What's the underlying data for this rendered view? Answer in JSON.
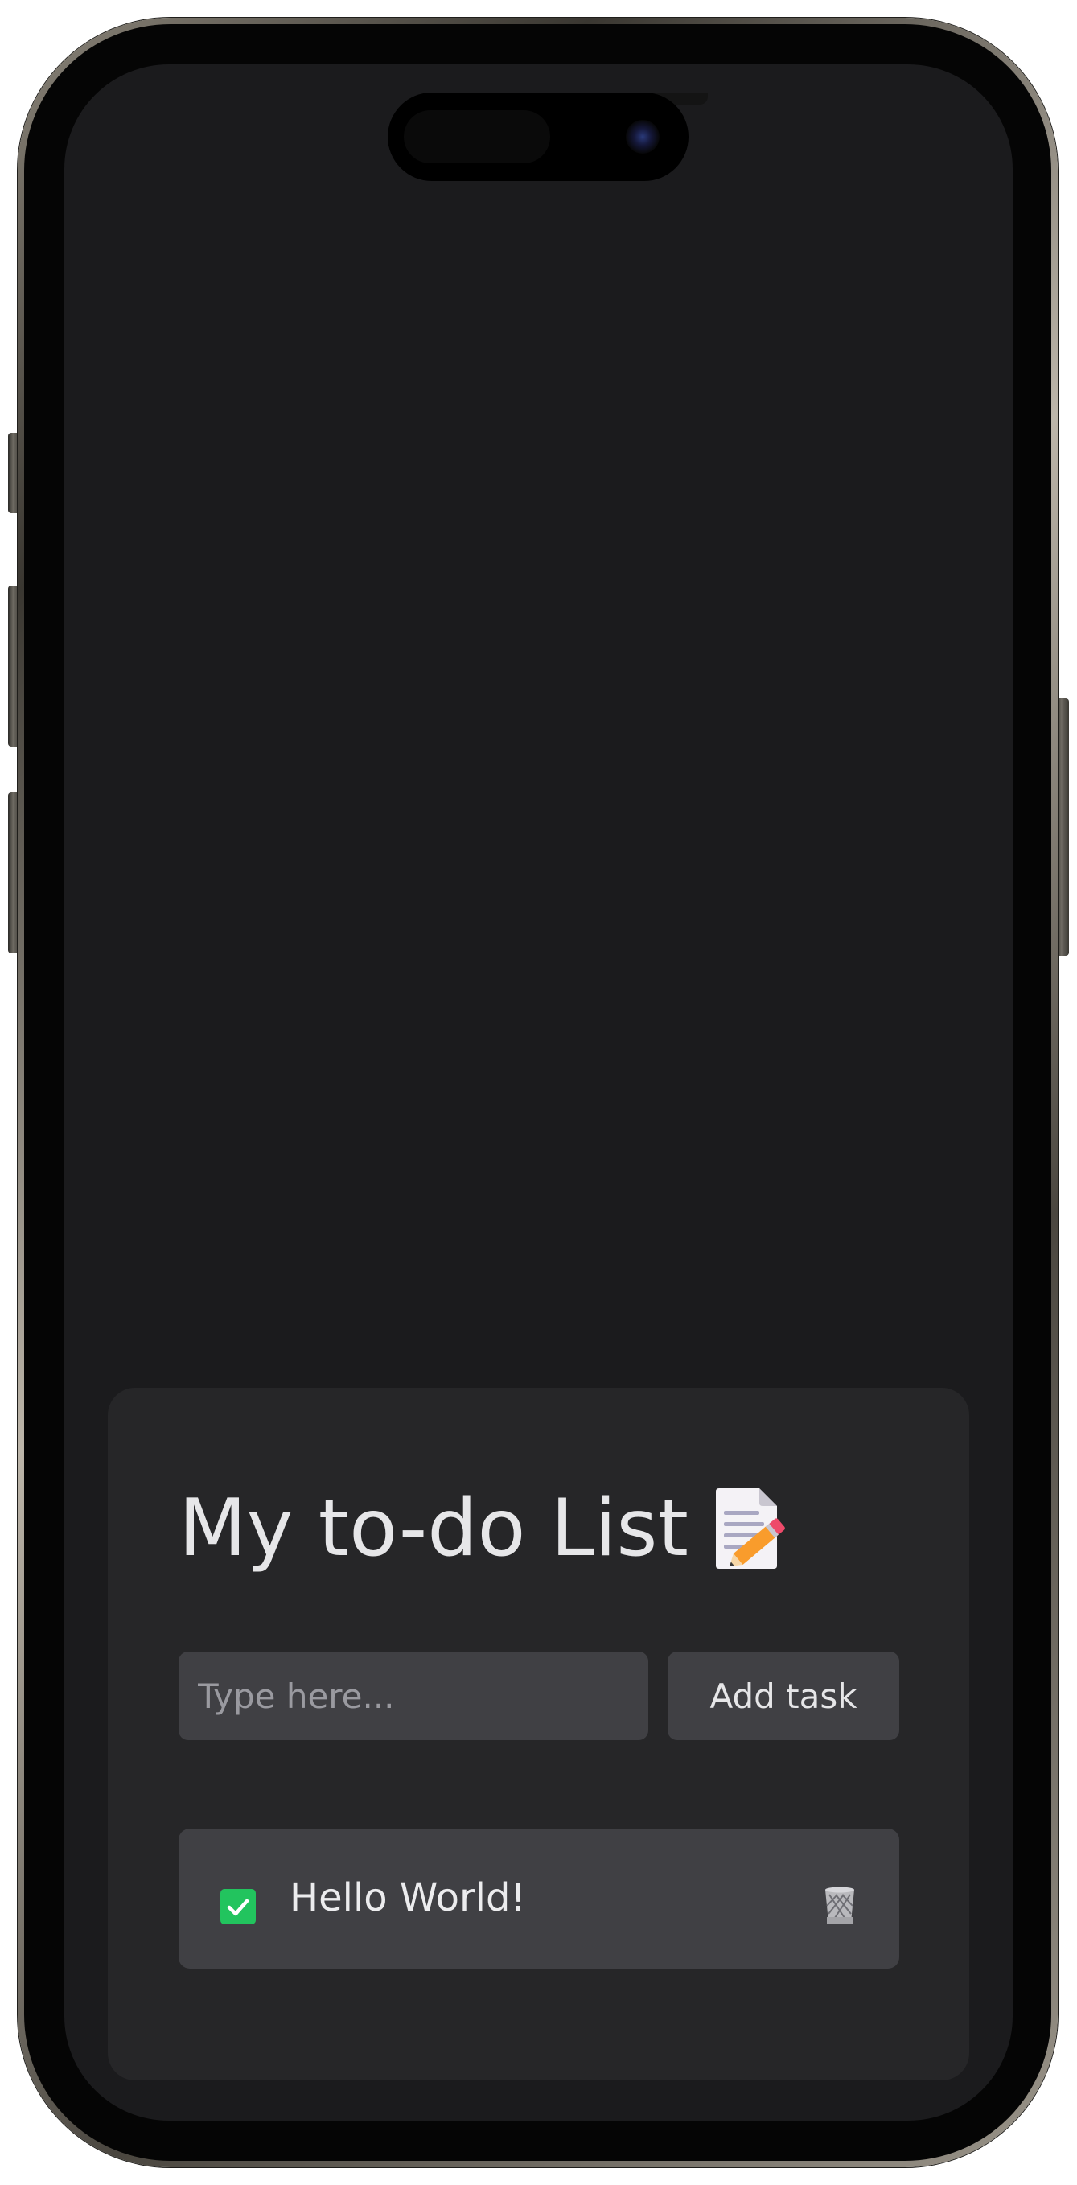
{
  "app": {
    "title": "My to-do List",
    "title_icon": "memo-icon"
  },
  "input": {
    "placeholder": "Type here...",
    "value": ""
  },
  "add_button": {
    "label": "Add task"
  },
  "tasks": [
    {
      "text": "Hello World!",
      "completed": true,
      "checkbox_icon": "checkmark-icon",
      "delete_icon": "wastebasket-icon"
    }
  ],
  "colors": {
    "screen_background": "#1b1b1d",
    "card_background": "#262628",
    "control_background": "#404044",
    "text": "#e6e6e8",
    "placeholder": "#9a9aa0",
    "checkbox_checked": "#22c45e"
  }
}
